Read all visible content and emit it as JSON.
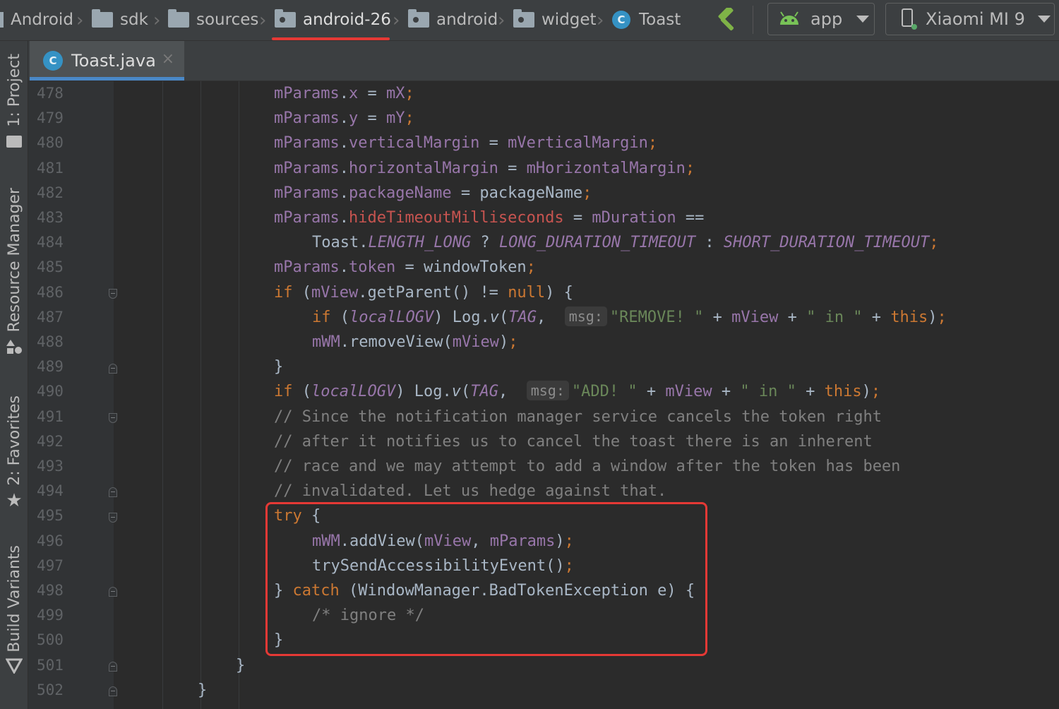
{
  "breadcrumbs": [
    "Android",
    "sdk",
    "sources",
    "android-26",
    "android",
    "widget",
    "Toast"
  ],
  "run_config": "app",
  "device": "Xiaomi MI 9",
  "tool_windows": [
    "1: Project",
    "Resource Manager",
    "2: Favorites",
    "Build Variants"
  ],
  "editor_tab": {
    "file": "Toast.java",
    "icon_letter": "C",
    "close": "×"
  },
  "line_numbers": [
    "478",
    "479",
    "480",
    "481",
    "482",
    "483",
    "484",
    "485",
    "486",
    "487",
    "488",
    "489",
    "490",
    "491",
    "492",
    "493",
    "494",
    "495",
    "496",
    "497",
    "498",
    "499",
    "500",
    "501",
    "502"
  ],
  "code": {
    "mParams": "mParams",
    "x": "x",
    "mX": "mX",
    "y": "y",
    "mY": "mY",
    "verticalMargin": "verticalMargin",
    "mVerticalMargin": "mVerticalMargin",
    "horizontalMargin": "horizontalMargin",
    "mHorizontalMargin": "mHorizontalMargin",
    "packageName_f": "packageName",
    "packageName_v": "packageName",
    "hideTimeout": "hideTimeoutMilliseconds",
    "mDuration": "mDuration",
    "Toast": "Toast",
    "LENGTH_LONG": "LENGTH_LONG",
    "LONG_TIMEOUT": "LONG_DURATION_TIMEOUT",
    "SHORT_TIMEOUT": "SHORT_DURATION_TIMEOUT",
    "token": "token",
    "windowToken": "windowToken",
    "kw_if": "if",
    "kw_null": "null",
    "kw_this": "this",
    "kw_try": "try",
    "kw_catch": "catch",
    "mView": "mView",
    "getParent": "getParent",
    "localLOGV": "localLOGV",
    "Log": "Log",
    "v": "v",
    "TAG": "TAG",
    "msg": "msg:",
    "str_remove": "\"REMOVE! \"",
    "str_in": "\" in \"",
    "str_add": "\"ADD! \"",
    "mWM": "mWM",
    "removeView": "removeView",
    "addView": "addView",
    "trySend": "trySendAccessibilityEvent",
    "WindowManager": "WindowManager",
    "BadToken": "BadTokenException",
    "e": "e",
    "comment1": "// Since the notification manager service cancels the token right",
    "comment2": "// after it notifies us to cancel the toast there is an inherent",
    "comment3": "// race and we may attempt to add a window after the token has been",
    "comment4": "// invalidated. Let us hedge against that.",
    "comment_ignore": "/* ignore */"
  },
  "colors": {
    "keyword": "#cc7832",
    "field": "#9876aa",
    "string": "#6a8759",
    "comment": "#808080",
    "text": "#a9b7c6",
    "highlight_box": "#e53935",
    "tab_underline": "#4a88c7",
    "active_crumb_underline": "#e53935"
  }
}
